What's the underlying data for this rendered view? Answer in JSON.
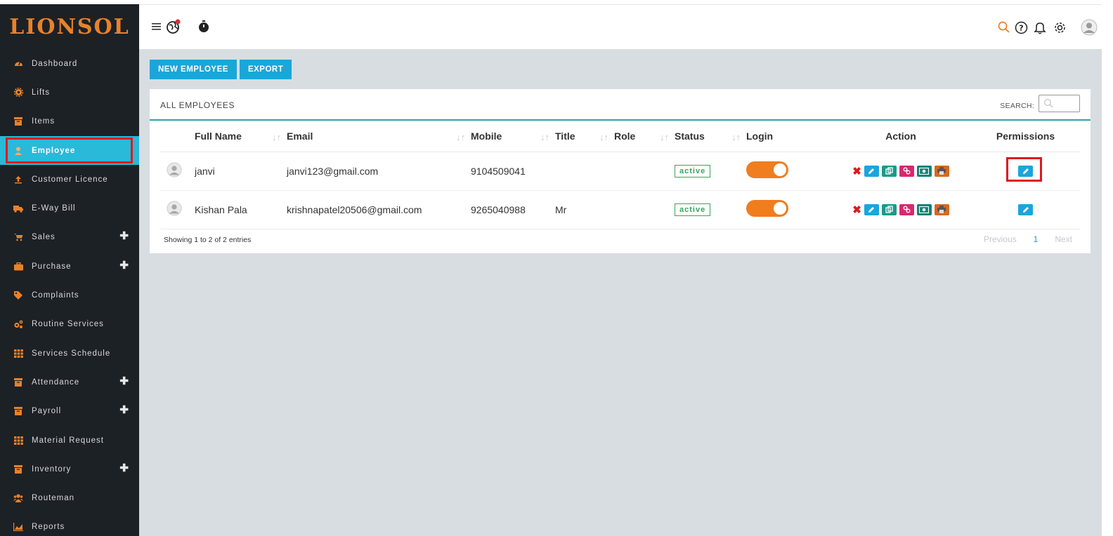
{
  "brand": {
    "logo_text": "LIONSOL",
    "accent": "#e8822a",
    "sidebar_bg": "#1c2126",
    "active_bg": "#29b9d9"
  },
  "sidebar": {
    "items": [
      {
        "label": "Dashboard",
        "icon": "dashboard-icon",
        "expandable": false
      },
      {
        "label": "Lifts",
        "icon": "cog-icon",
        "expandable": false
      },
      {
        "label": "Items",
        "icon": "archive-icon",
        "expandable": false
      },
      {
        "label": "Employee",
        "icon": "user-icon",
        "expandable": false,
        "active": true
      },
      {
        "label": "Customer Licence",
        "icon": "upload-icon",
        "expandable": false
      },
      {
        "label": "E-Way Bill",
        "icon": "truck-icon",
        "expandable": false
      },
      {
        "label": "Sales",
        "icon": "cart-icon",
        "expandable": true
      },
      {
        "label": "Purchase",
        "icon": "briefcase-icon",
        "expandable": true
      },
      {
        "label": "Complaints",
        "icon": "tag-icon",
        "expandable": false
      },
      {
        "label": "Routine Services",
        "icon": "cogs-icon",
        "expandable": false
      },
      {
        "label": "Services Schedule",
        "icon": "grid-icon",
        "expandable": false
      },
      {
        "label": "Attendance",
        "icon": "archive-icon",
        "expandable": true
      },
      {
        "label": "Payroll",
        "icon": "archive-icon",
        "expandable": true
      },
      {
        "label": "Material Request",
        "icon": "grid-icon",
        "expandable": false
      },
      {
        "label": "Inventory",
        "icon": "archive-icon",
        "expandable": true
      },
      {
        "label": "Routeman",
        "icon": "users-icon",
        "expandable": false
      },
      {
        "label": "Reports",
        "icon": "chart-icon",
        "expandable": false
      }
    ]
  },
  "toolbar": {
    "new_employee": "NEW EMPLOYEE",
    "export": "EXPORT"
  },
  "card": {
    "title": "ALL EMPLOYEES",
    "search_label": "SEARCH:",
    "search_value": ""
  },
  "table": {
    "columns": [
      "Full Name",
      "Email",
      "Mobile",
      "Title",
      "Role",
      "Status",
      "Login",
      "Action",
      "Permissions"
    ],
    "rows": [
      {
        "name": "janvi",
        "email": "janvi123@gmail.com",
        "mobile": "9104509041",
        "title": "",
        "role": "",
        "status": "active",
        "login": true
      },
      {
        "name": "Kishan Pala",
        "email": "krishnapatel20506@gmail.com",
        "mobile": "9265040988",
        "title": "Mr",
        "role": "",
        "status": "active",
        "login": true
      }
    ]
  },
  "footer": {
    "info": "Showing 1 to 2 of 2 entries",
    "previous": "Previous",
    "page": "1",
    "next": "Next"
  }
}
